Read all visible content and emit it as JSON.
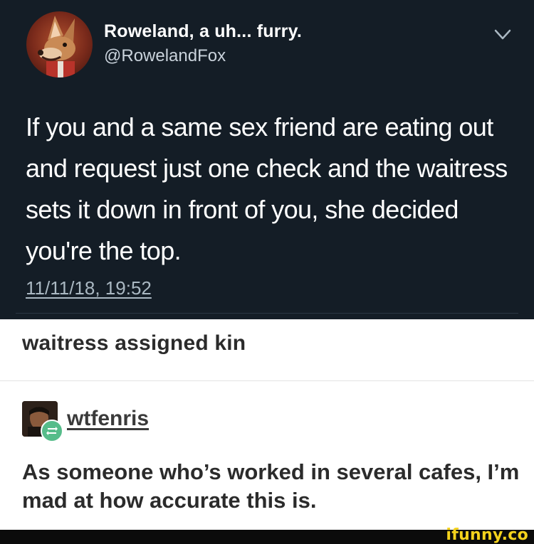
{
  "tweet": {
    "display_name": "Roweland, a uh... furry.",
    "handle": "@RowelandFox",
    "text": "If you and a same sex friend are eating out and request just one check and the waitress sets it down in front of you, she decided you're the top.",
    "timestamp": "11/11/18, 19:52",
    "avatar_icon": "fox-avatar-icon",
    "menu_icon": "chevron-down-icon",
    "background": "#141d26"
  },
  "caption": "waitress assigned kin",
  "reblog": {
    "username": "wtfenris",
    "comment": "As someone who’s worked in several cafes, I’m mad at how accurate this is.",
    "badge_icon": "reblog-icon",
    "badge_color": "#56bc8a"
  },
  "watermark": {
    "text": "ifunny.co",
    "color": "#f4d21c"
  }
}
